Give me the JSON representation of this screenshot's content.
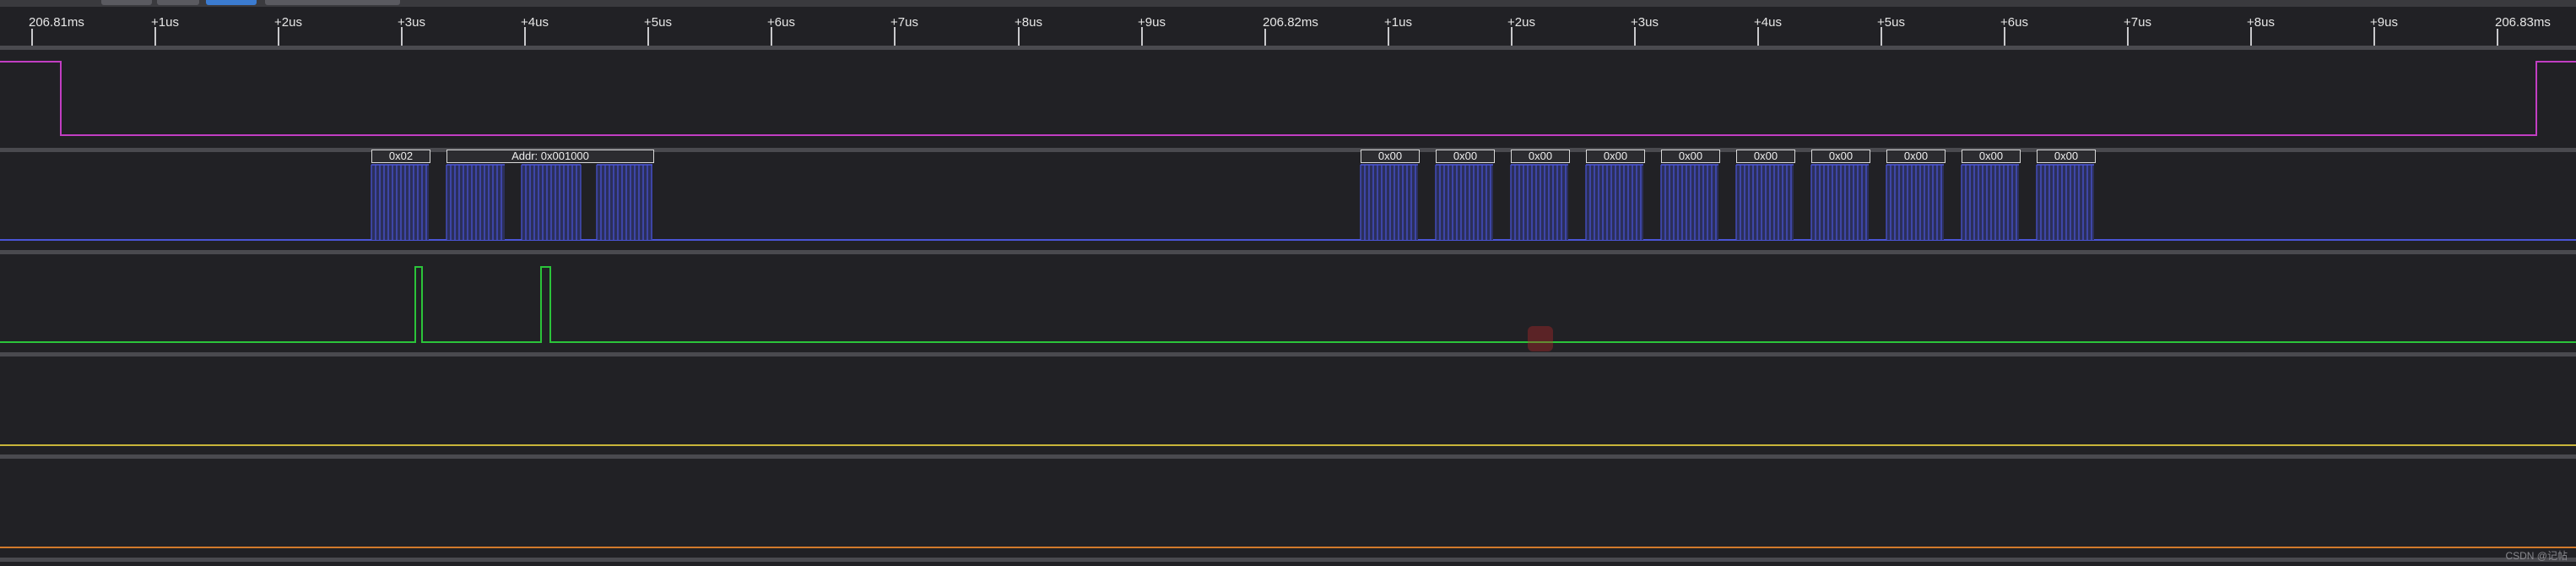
{
  "ruler": {
    "labels": [
      "206.81ms",
      "+1us",
      "+2us",
      "+3us",
      "+4us",
      "+5us",
      "+6us",
      "+7us",
      "+8us",
      "+9us",
      "206.82ms",
      "+1us",
      "+2us",
      "+3us",
      "+4us",
      "+5us",
      "+6us",
      "+7us",
      "+8us",
      "+9us",
      "206.83ms"
    ]
  },
  "channels": {
    "ch1": {
      "color": "#c23ec3"
    },
    "ch2": {
      "color": "#4a55d8",
      "decodes": [
        "0x02",
        "Addr: 0x001000",
        "0x00",
        "0x00",
        "0x00",
        "0x00",
        "0x00",
        "0x00",
        "0x00",
        "0x00",
        "0x00",
        "0x00"
      ]
    },
    "ch3": {
      "color": "#2bc43a"
    },
    "ch4": {
      "color": "#c9b53a"
    },
    "ch5": {
      "color": "#d27a2b"
    }
  },
  "watermark": "CSDN @记帖"
}
